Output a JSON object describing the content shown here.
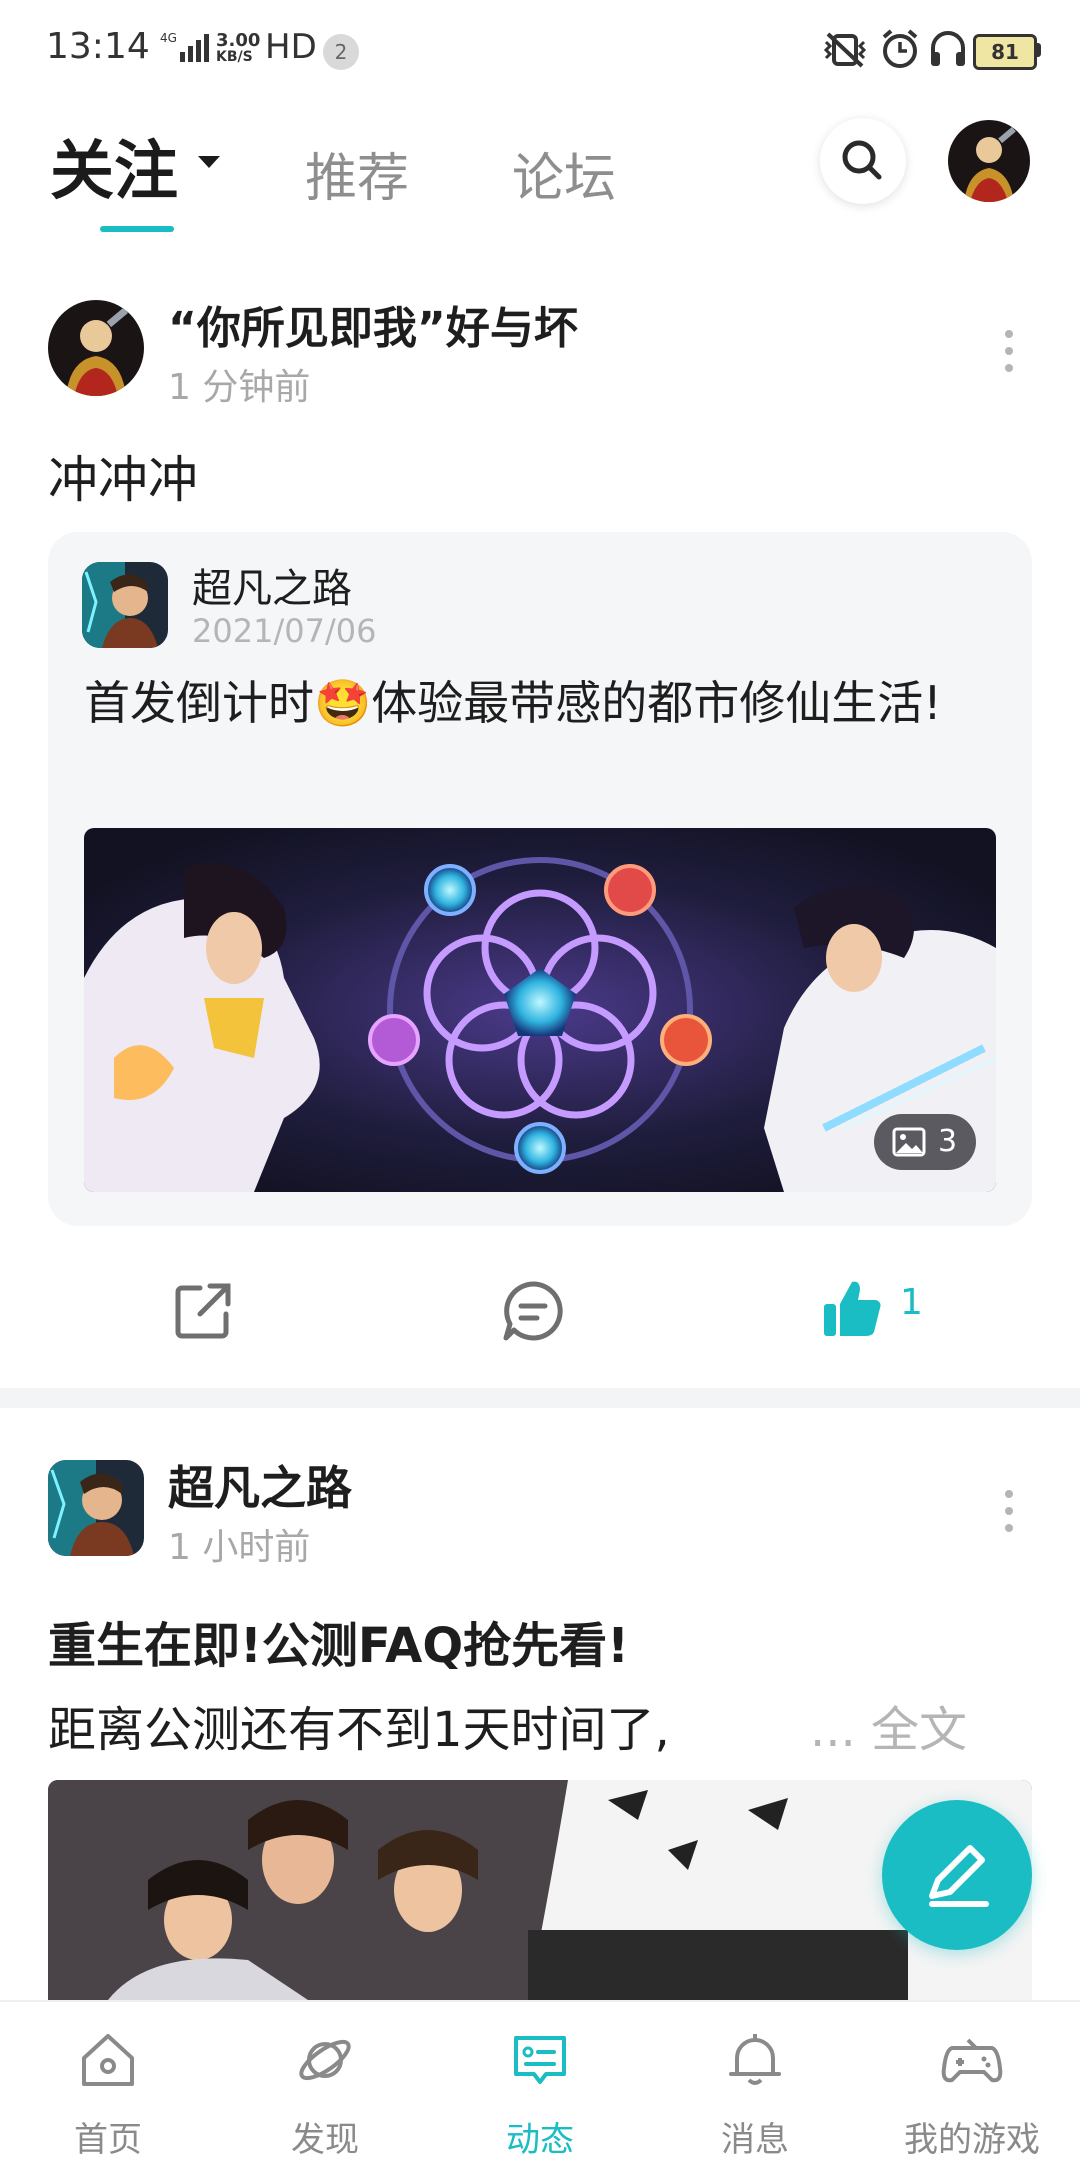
{
  "status_bar": {
    "time": "13:14",
    "network": "4G",
    "speed_value": "3.00",
    "speed_unit": "KB/S",
    "hd": "HD",
    "notif_count": "2",
    "battery": "81"
  },
  "top_tabs": {
    "follow": "关注",
    "recommend": "推荐",
    "forum": "论坛"
  },
  "post1": {
    "author": "“你所见即我”好与坏",
    "time": "1 分钟前",
    "text": "冲冲冲",
    "card": {
      "title": "超凡之路",
      "date": "2021/07/06",
      "text": "首发倒计时🤩体验最带感的都市修仙生活!",
      "image_count": "3"
    },
    "likes": "1"
  },
  "post2": {
    "author": "超凡之路",
    "time": "1 小时前",
    "title": "重生在即!公测FAQ抢先看!",
    "summary": "距离公测还有不到1天时间了,",
    "more": "... 全文"
  },
  "bottom_nav": {
    "home": "首页",
    "discover": "发现",
    "dynamic": "动态",
    "messages": "消息",
    "my_games": "我的游戏"
  },
  "colors": {
    "accent": "#1bbdc4",
    "text": "#1e1e1e",
    "muted": "#a8a8a8"
  }
}
